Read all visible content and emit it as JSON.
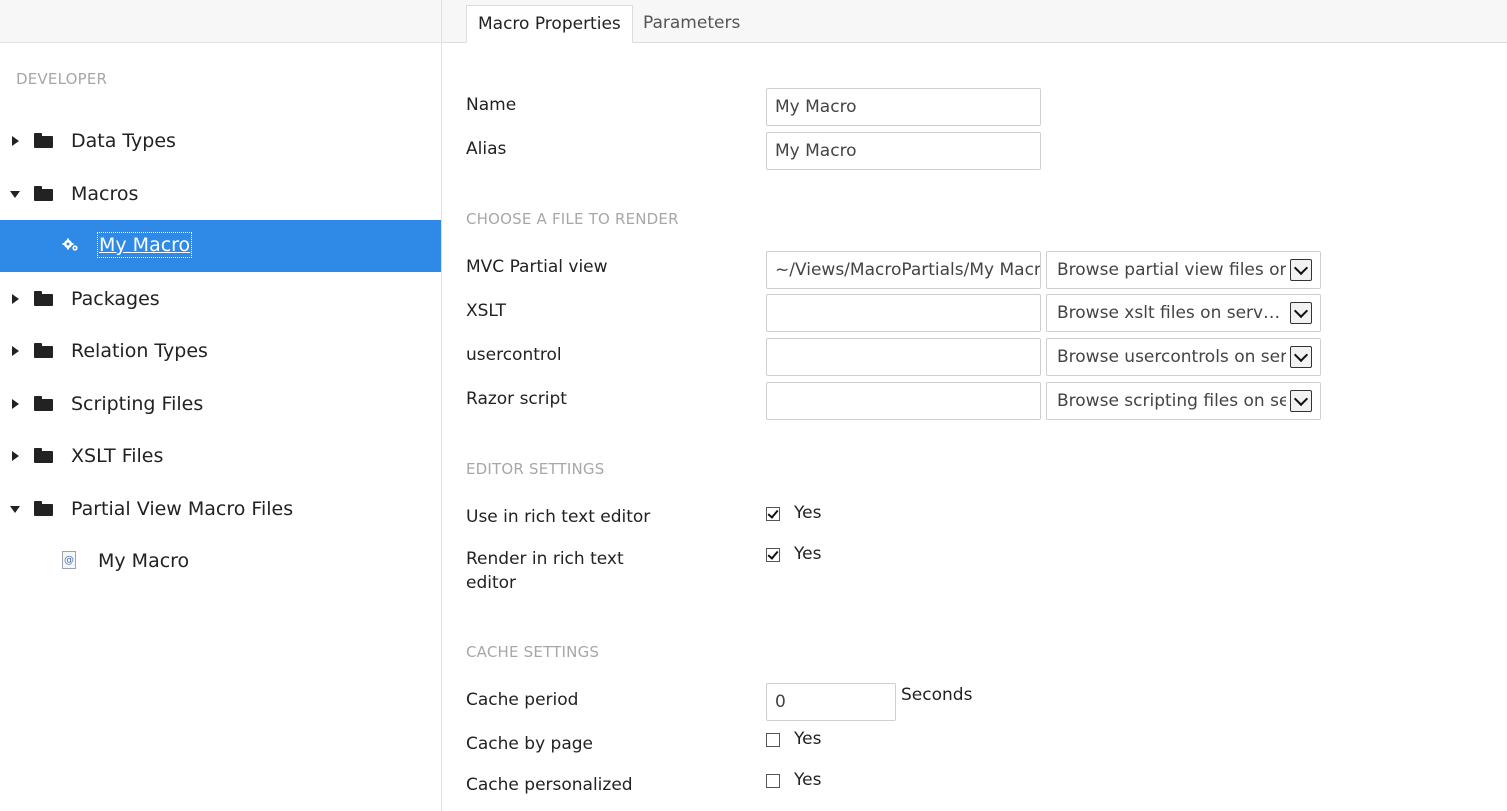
{
  "tree": {
    "section_title": "DEVELOPER",
    "items": [
      {
        "label": "Data Types",
        "expanded": false
      },
      {
        "label": "Macros",
        "expanded": true
      },
      {
        "label": "My Macro",
        "child": true,
        "selected": true,
        "icon": "gears-icon"
      },
      {
        "label": "Packages",
        "expanded": false
      },
      {
        "label": "Relation Types",
        "expanded": false
      },
      {
        "label": "Scripting Files",
        "expanded": false
      },
      {
        "label": "XSLT Files",
        "expanded": false
      },
      {
        "label": "Partial View Macro Files",
        "expanded": true
      },
      {
        "label": "My Macro",
        "child": true,
        "selected": false,
        "icon": "partial-view-file-icon",
        "icon_glyph": "@"
      }
    ]
  },
  "tabs": [
    {
      "label": "Macro Properties",
      "active": true
    },
    {
      "label": "Parameters",
      "active": false
    }
  ],
  "properties": {
    "name_label": "Name",
    "name_value": "My  Macro",
    "alias_label": "Alias",
    "alias_value": "My  Macro"
  },
  "render": {
    "title": "CHOOSE A FILE TO RENDER",
    "rows": [
      {
        "label": "MVC Partial view",
        "value": "~/Views/MacroPartials/My Macr",
        "select": "Browse partial view files on s"
      },
      {
        "label": "XSLT",
        "value": "",
        "select": "Browse xslt files on server..."
      },
      {
        "label": "usercontrol",
        "value": "",
        "select": "Browse usercontrols on serv"
      },
      {
        "label": "Razor script",
        "value": "",
        "select": "Browse scripting files on ser"
      }
    ]
  },
  "editor": {
    "title": "EDITOR SETTINGS",
    "use_label": "Use in rich text editor",
    "use_checked": true,
    "render_label_line1": "Render in rich text",
    "render_label_line2": "editor",
    "render_checked": true,
    "yes_label": "Yes"
  },
  "cache": {
    "title": "CACHE SETTINGS",
    "period_label": "Cache period",
    "period_value": "0",
    "period_unit": "Seconds",
    "by_page_label": "Cache by page",
    "by_page_checked": false,
    "personalized_label": "Cache personalized",
    "personalized_checked": false,
    "yes_label": "Yes"
  },
  "colors": {
    "selected_bg": "#2e8ae6",
    "section_title": "#a7a7a7"
  }
}
